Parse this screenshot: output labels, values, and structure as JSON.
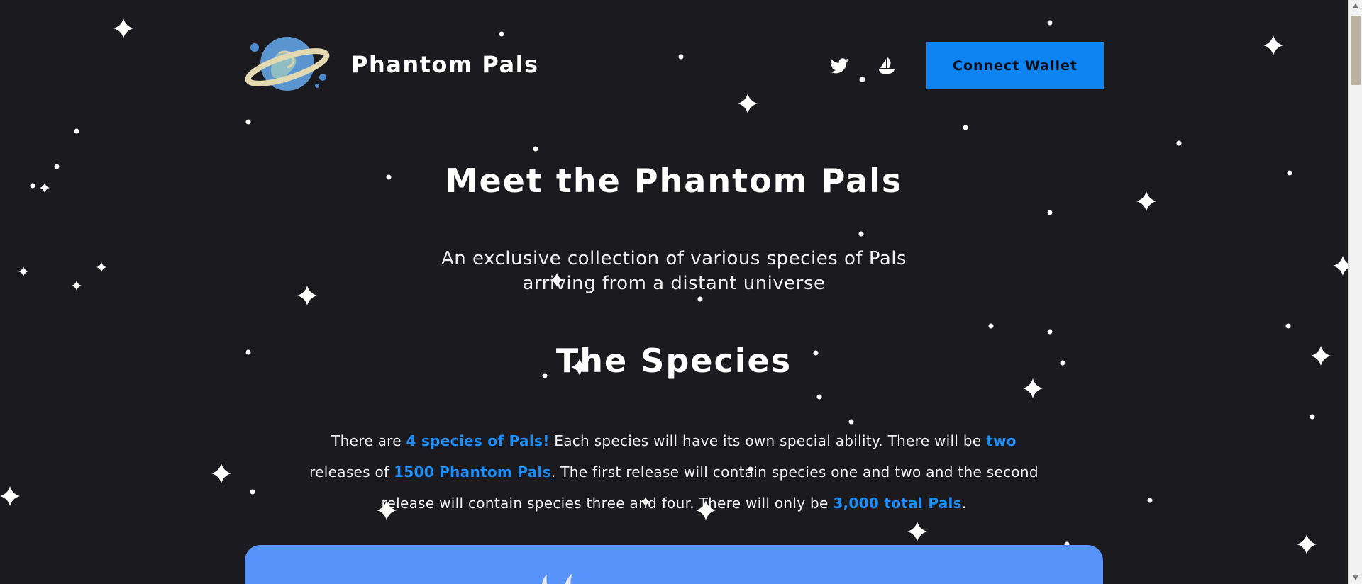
{
  "header": {
    "brand": "Phantom Pals",
    "social": [
      "twitter-icon",
      "opensea-icon"
    ],
    "connect_label": "Connect Wallet"
  },
  "hero": {
    "title": "Meet the Phantom Pals",
    "subtitle": "An exclusive collection of various species of Pals arriving from a distant universe"
  },
  "species": {
    "title": "The Species",
    "p1": "There are ",
    "h1": "4 species of Pals!",
    "p2": " Each species will have its own special ability. There will be ",
    "h2": "two",
    "p3": " releases of ",
    "h3": "1500 Phantom Pals",
    "p4": ". The first release will contain species one and two and the second release will contain species three and four. There will only be ",
    "h4": "3,000 total Pals",
    "p5": "."
  },
  "colors": {
    "background": "#1b1a1f",
    "accent": "#1d8ef7",
    "button": "#0d84f2",
    "panel": "#5793fb"
  }
}
